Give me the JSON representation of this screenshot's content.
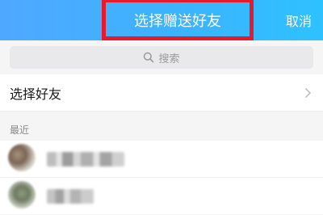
{
  "header": {
    "title": "选择赠送好友",
    "cancel_label": "取消"
  },
  "search": {
    "placeholder": "搜索"
  },
  "choose_friends": {
    "label": "选择好友"
  },
  "recent": {
    "section_label": "最近"
  },
  "colors": {
    "header_blue": "#3cb3ff",
    "highlight_red": "#e8192b"
  }
}
